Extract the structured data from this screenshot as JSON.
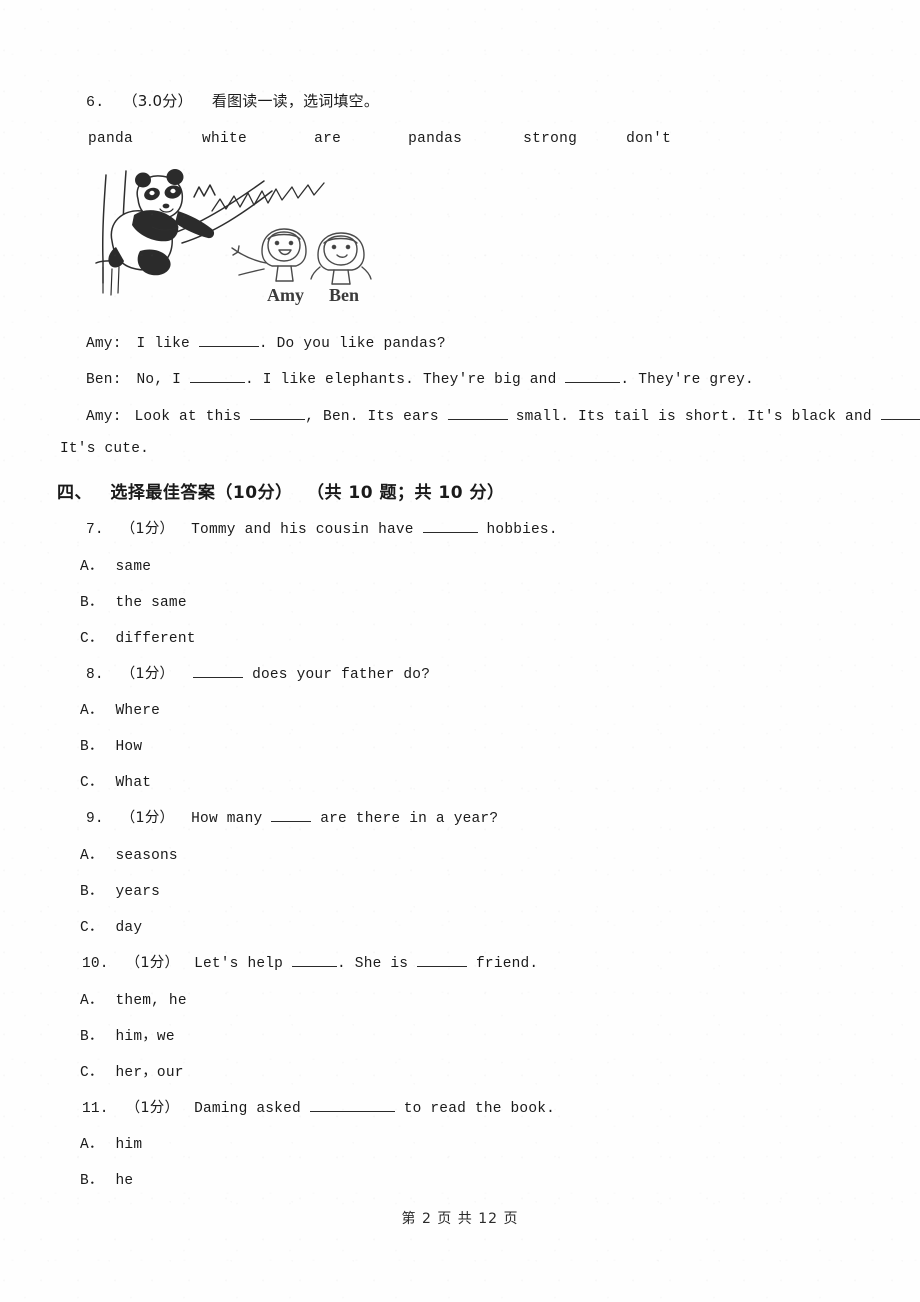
{
  "question6": {
    "number": "6.",
    "marks": "（3.0分）",
    "prompt": "看图读一读，选词填空。",
    "word_bank": [
      "panda",
      "white",
      "are",
      "pandas",
      "strong",
      "don't"
    ],
    "figure": {
      "caption_left": "Amy",
      "caption_right": "Ben",
      "description": "panda-climbing-tree-and-two-children-drawing"
    },
    "dialogue": [
      {
        "speaker": "Amy:",
        "part1": "I like",
        "part2": ". Do you like pandas?"
      },
      {
        "speaker": "Ben:",
        "part1": "No, I",
        "part2": ". I like elephants. They're big and",
        "part3": ". They're grey."
      },
      {
        "speaker": "Amy:",
        "part1": "Look at this",
        "part2": ", Ben. Its ears",
        "part3": "small. Its tail is short. It's black and",
        "part4": ".",
        "wrap": "It's cute."
      }
    ]
  },
  "section4": {
    "index": "四、",
    "title": "选择最佳答案（10分）",
    "meta": "（共 10 题；共 10 分）"
  },
  "questions": [
    {
      "number": "7.",
      "marks": "（1分）",
      "stem_before": "Tommy and his cousin have",
      "stem_after": "hobbies.",
      "blank": "u-55",
      "options": [
        {
          "letter": "A．",
          "text": "same"
        },
        {
          "letter": "B．",
          "text": "the same"
        },
        {
          "letter": "C．",
          "text": "different"
        }
      ]
    },
    {
      "number": "8.",
      "marks": "（1分）",
      "stem_before": "",
      "stem_after": "does your father do?",
      "blank": "u-50",
      "options": [
        {
          "letter": "A．",
          "text": "Where"
        },
        {
          "letter": "B．",
          "text": "How"
        },
        {
          "letter": "C．",
          "text": "What"
        }
      ]
    },
    {
      "number": "9.",
      "marks": "（1分）",
      "stem_before": "How many",
      "stem_after": "are there in a year?",
      "blank": "u-40",
      "options": [
        {
          "letter": "A．",
          "text": "seasons"
        },
        {
          "letter": "B．",
          "text": "years"
        },
        {
          "letter": "C．",
          "text": "day"
        }
      ]
    },
    {
      "number": "10.",
      "marks": "（1分）",
      "stem_before": "Let's help",
      "stem_mid": ". She is",
      "stem_after": "friend.",
      "blank": "u-45",
      "blank2": "u-50",
      "options": [
        {
          "letter": "A．",
          "text": "them, he"
        },
        {
          "letter": "B．",
          "text": "him，we"
        },
        {
          "letter": "C．",
          "text": "her，our"
        }
      ]
    },
    {
      "number": "11.",
      "marks": "（1分）",
      "stem_before": "Daming asked",
      "stem_after": "to read the book.",
      "blank": "u-85",
      "options": [
        {
          "letter": "A．",
          "text": "him"
        },
        {
          "letter": "B．",
          "text": "he"
        }
      ]
    }
  ],
  "footer": {
    "text": "第 2 页 共 12 页"
  }
}
